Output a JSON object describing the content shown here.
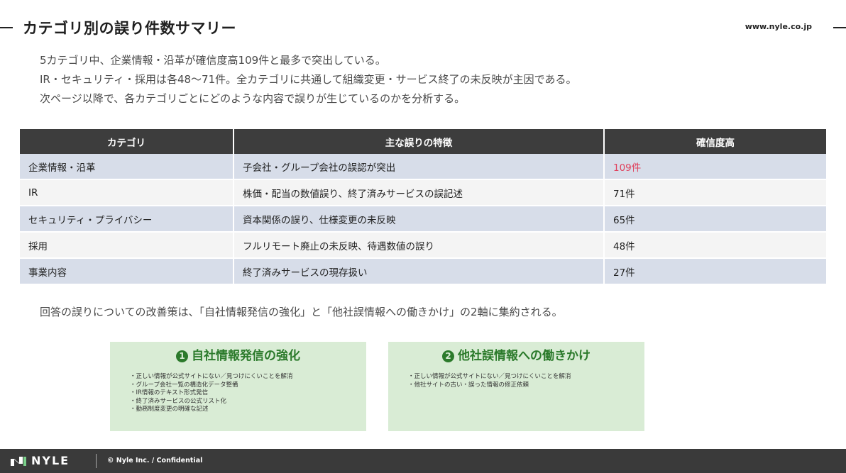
{
  "header": {
    "title": "カテゴリ別の誤り件数サマリー",
    "url": "www.nyle.co.jp"
  },
  "intro": [
    "5カテゴリ中、企業情報・沿革が確信度高109件と最多で突出している。",
    "IR・セキュリティ・採用は各48〜71件。全カテゴリに共通して組織変更・サービス終了の未反映が主因である。",
    "次ページ以降で、各カテゴリごとにどのような内容で誤りが生じているのかを分析する。"
  ],
  "table": {
    "headers": [
      "カテゴリ",
      "主な誤りの特徴",
      "確信度高"
    ],
    "rows": [
      [
        "企業情報・沿革",
        "子会社・グループ会社の誤認が突出",
        "109件"
      ],
      [
        "IR",
        "株価・配当の数値誤り、終了済みサービスの誤記述",
        "71件"
      ],
      [
        "セキュリティ・プライバシー",
        "資本関係の誤り、仕様変更の未反映",
        "65件"
      ],
      [
        "採用",
        "フルリモート廃止の未反映、待遇数値の誤り",
        "48件"
      ],
      [
        "事業内容",
        "終了済みサービスの現存扱い",
        "27件"
      ]
    ],
    "highlight_color": "#e0405c"
  },
  "conclusion": "回答の誤りについての改善策は、「自社情報発信の強化」と「他社誤情報への働きかけ」の2軸に集約される。",
  "boxes": [
    {
      "number": "1",
      "title": "自社情報発信の強化",
      "items": [
        "正しい情報が公式サイトにない／見つけにくいことを解消",
        "グループ会社一覧の構造化データ整備",
        "IR情報のテキスト形式発信",
        "終了済みサービスの公式リスト化",
        "勤務制度変更の明確な記述"
      ]
    },
    {
      "number": "2",
      "title": "他社誤情報への働きかけ",
      "items": [
        "正しい情報が公式サイトにない／見つけにくいことを解消",
        "他社サイトの古い・誤った情報の修正依頼"
      ]
    }
  ],
  "footer": {
    "logo": "NYLE",
    "copyright": "© Nyle Inc. / Confidential"
  }
}
